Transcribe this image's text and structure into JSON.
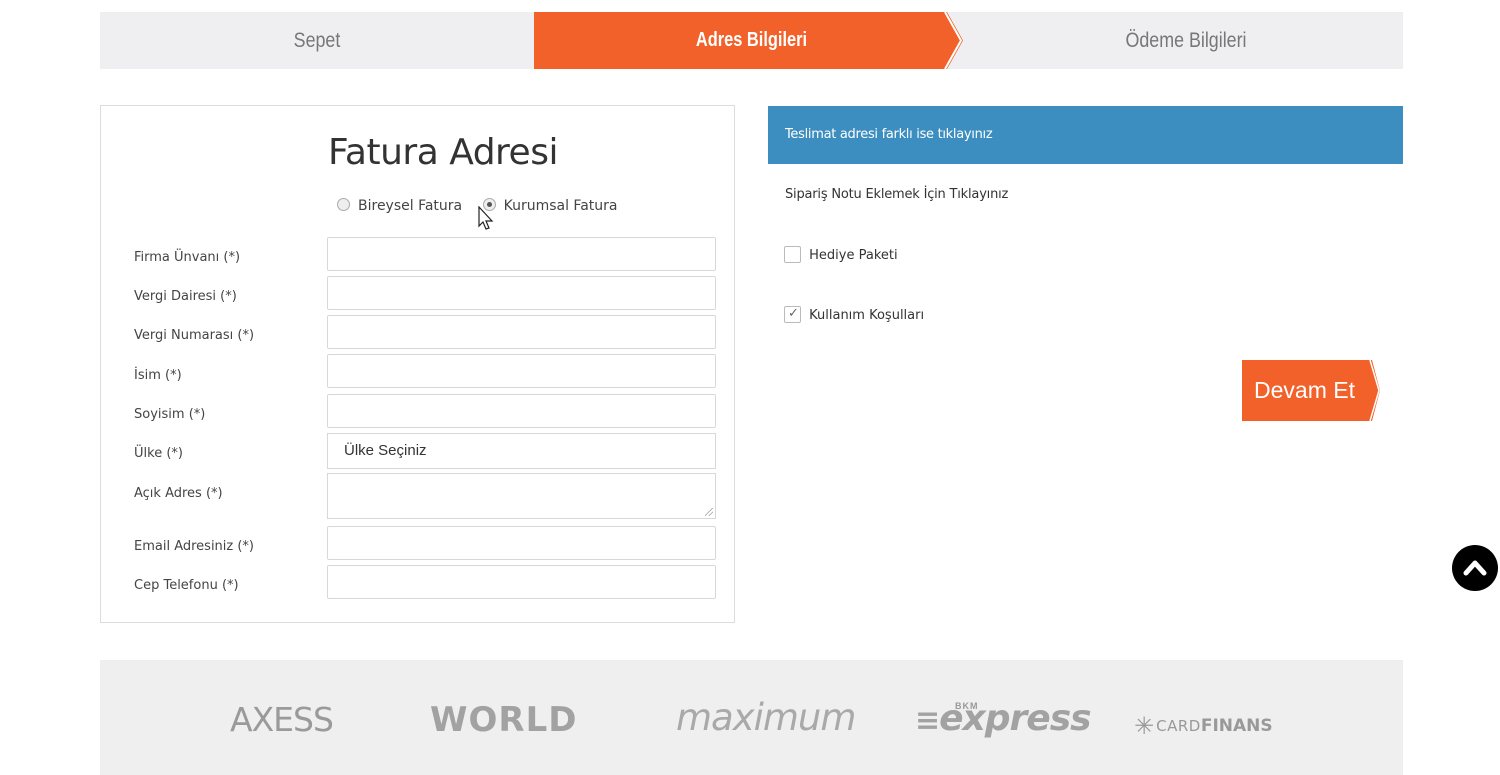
{
  "steps": {
    "cart": "Sepet",
    "address": "Adres Bilgileri",
    "payment": "Ödeme Bilgileri"
  },
  "billing": {
    "title": "Fatura Adresi",
    "invoice_types": [
      "Bireysel Fatura",
      "Kurumsal Fatura"
    ],
    "selected_invoice_type": "Kurumsal Fatura",
    "fields": {
      "company": "Firma Ünvanı (*)",
      "tax_office": "Vergi Dairesi (*)",
      "tax_number": "Vergi Numarası (*)",
      "first_name": "İsim (*)",
      "last_name": "Soyisim (*)",
      "country": "Ülke (*)",
      "address": "Açık Adres (*)",
      "email": "Email Adresiniz (*)",
      "phone": "Cep Telefonu (*)"
    },
    "country_value": "Ülke Seçiniz"
  },
  "side": {
    "delivery_toggle": "Teslimat adresi farklı ise tıklayınız",
    "order_note": "Sipariş Notu Eklemek İçin Tıklayınız",
    "gift_package": "Hediye Paketi",
    "gift_package_checked": false,
    "terms": "Kullanım Koşulları",
    "terms_checked": true,
    "continue": "Devam Et"
  },
  "footer": {
    "logos": [
      "AXESS",
      "WORLD",
      "maximum",
      "express",
      "CARDFINANS"
    ],
    "bkm_text": "BKM",
    "cardfinans_card": "CARD",
    "cardfinans_finans": "FINANS"
  },
  "colors": {
    "accent": "#f2612a",
    "info_bar": "#3b8ebf",
    "steps_bg": "#efeff2",
    "footer_bg": "#efefef"
  }
}
